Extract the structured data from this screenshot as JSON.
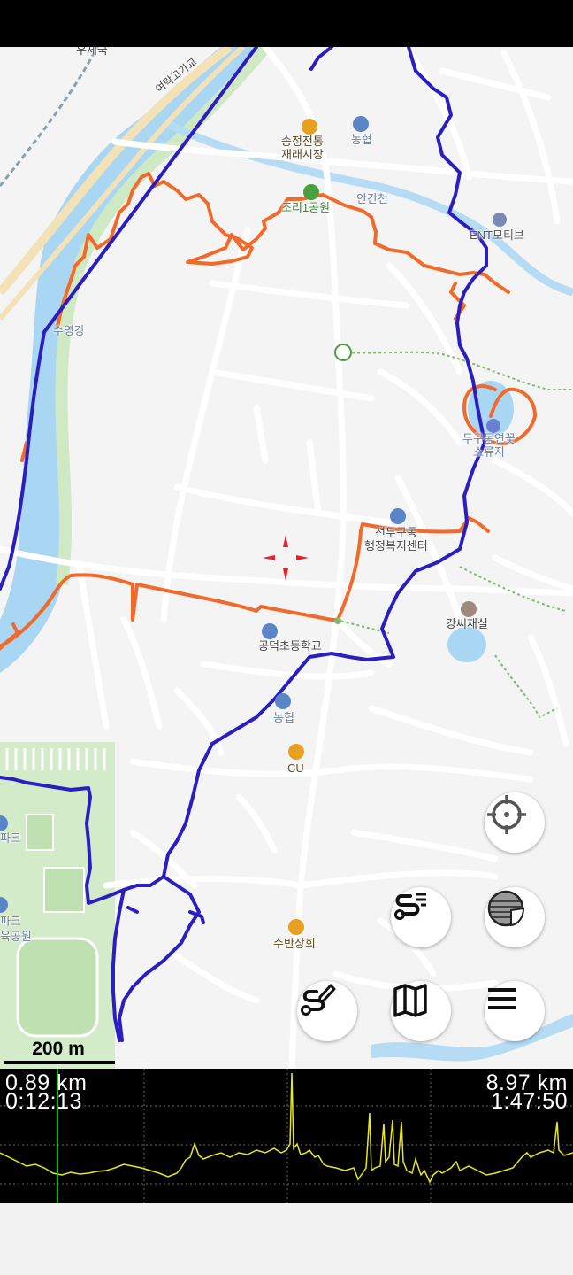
{
  "colors": {
    "route_blue": "#2b1ec0",
    "track_orange": "#f26a2a",
    "water": "#9dd0f0",
    "park": "#cfe9c4",
    "elevation": "#e8e81a",
    "cursor": "#00c000",
    "crosshair": "#e8202a"
  },
  "map": {
    "labels": {
      "post_office": "우체국",
      "bridge": "여락고가교",
      "market": "송정전통\n재래시장",
      "nonghyup_top": "농협",
      "park_top": "조리1공원",
      "stream": "안간천",
      "company": "ENT모티브",
      "river": "수영강",
      "reservoir": "두구동연꽃\n소류지",
      "district_office": "선두구동\n행정복지센터",
      "clan_hall": "강씨재실",
      "school": "공덕초등학교",
      "nonghyup_mid": "농협",
      "cu": "CU",
      "shop": "수반상회",
      "park_left1": "파크",
      "park_left2": "파크",
      "park_left3": "육공원"
    },
    "scale_label": "200 m"
  },
  "buttons": {
    "locate": "crosshair-target-icon",
    "layers": "layers-icon",
    "route_list": "route-list-icon",
    "map": "folded-map-icon",
    "edit_route": "edit-route-icon",
    "menu": "hamburger-menu-icon"
  },
  "profile": {
    "distance_current": "0.89 km",
    "time_current": "0:12:13",
    "distance_total": "8.97 km",
    "time_total": "1:47:50",
    "cursor_fraction": 0.1
  }
}
